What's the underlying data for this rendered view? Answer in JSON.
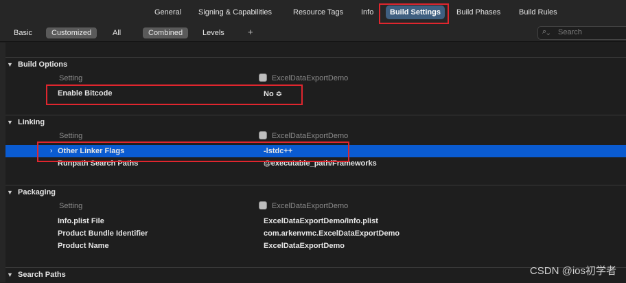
{
  "tabs": [
    {
      "label": "General"
    },
    {
      "label": "Signing & Capabilities"
    },
    {
      "label": "Resource Tags"
    },
    {
      "label": "Info"
    },
    {
      "label": "Build Settings",
      "active": true
    },
    {
      "label": "Build Phases"
    },
    {
      "label": "Build Rules"
    }
  ],
  "filters": {
    "basic": "Basic",
    "customized": "Customized",
    "all": "All",
    "combined": "Combined",
    "levels": "Levels",
    "add": "+"
  },
  "search": {
    "placeholder": "Search"
  },
  "sections": {
    "build_options": {
      "title": "Build Options",
      "header_setting": "Setting",
      "header_project": "ExcelDataExportDemo",
      "rows": [
        {
          "name": "Enable Bitcode",
          "value": "No ≎"
        }
      ]
    },
    "linking": {
      "title": "Linking",
      "header_setting": "Setting",
      "header_project": "ExcelDataExportDemo",
      "rows": [
        {
          "name": "Other Linker Flags",
          "value": "-lstdc++"
        },
        {
          "name": "Runpath Search Paths",
          "value": "@executable_path/Frameworks"
        }
      ]
    },
    "packaging": {
      "title": "Packaging",
      "header_setting": "Setting",
      "header_project": "ExcelDataExportDemo",
      "rows": [
        {
          "name": "Info.plist File",
          "value": "ExcelDataExportDemo/Info.plist"
        },
        {
          "name": "Product Bundle Identifier",
          "value": "com.arkenvmc.ExcelDataExportDemo"
        },
        {
          "name": "Product Name",
          "value": "ExcelDataExportDemo"
        }
      ]
    },
    "search_paths": {
      "title": "Search Paths"
    }
  },
  "watermark": "CSDN @ios初学者",
  "colors": {
    "selection": "#0a5bd1",
    "active_tab": "#3f5f80",
    "highlight_box": "#e0262e"
  }
}
